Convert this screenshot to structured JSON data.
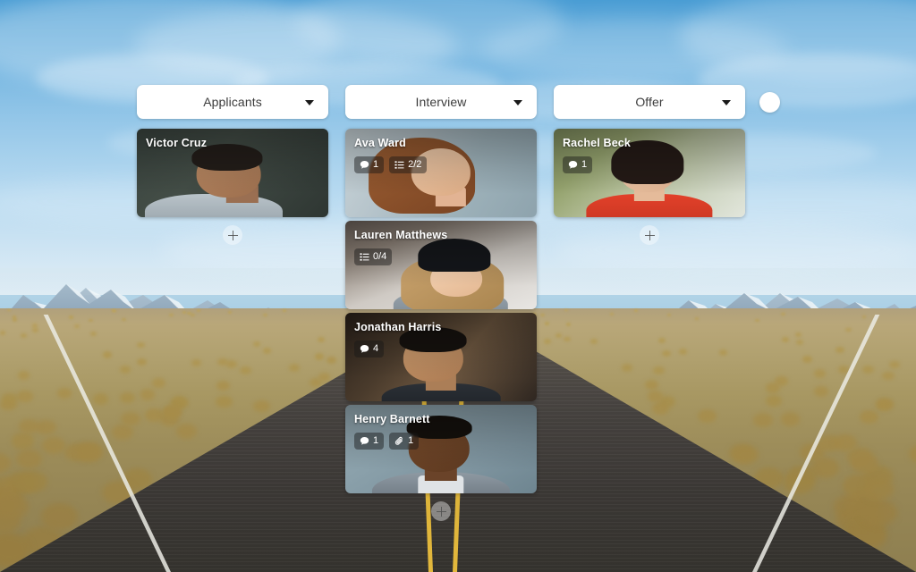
{
  "board": {
    "add_list_label": "+",
    "add_list_icon": "plus-icon"
  },
  "columns": [
    {
      "id": "applicants",
      "title": "Applicants",
      "caret_icon": "chevron-down-icon",
      "add_card_icon": "plus-icon",
      "cards": [
        {
          "name": "Victor Cruz",
          "badges": []
        }
      ]
    },
    {
      "id": "interview",
      "title": "Interview",
      "caret_icon": "chevron-down-icon",
      "add_card_icon": "plus-icon",
      "cards": [
        {
          "name": "Ava Ward",
          "badges": [
            {
              "icon": "comment-icon",
              "value": "1"
            },
            {
              "icon": "checklist-icon",
              "value": "2/2"
            }
          ]
        },
        {
          "name": "Lauren Matthews",
          "badges": [
            {
              "icon": "checklist-icon",
              "value": "0/4"
            }
          ]
        },
        {
          "name": "Jonathan Harris",
          "badges": [
            {
              "icon": "comment-icon",
              "value": "4"
            }
          ]
        },
        {
          "name": "Henry Barnett",
          "badges": [
            {
              "icon": "comment-icon",
              "value": "1"
            },
            {
              "icon": "attachment-icon",
              "value": "1"
            }
          ]
        }
      ]
    },
    {
      "id": "offer",
      "title": "Offer",
      "caret_icon": "chevron-down-icon",
      "add_card_icon": "plus-icon",
      "cards": [
        {
          "name": "Rachel Beck",
          "badges": [
            {
              "icon": "comment-icon",
              "value": "1"
            }
          ]
        }
      ]
    }
  ],
  "colors": {
    "header_bg": "#ffffff",
    "header_text": "#3c3c3c",
    "card_name_text": "#ffffff",
    "badge_bg": "rgba(25,25,25,0.46)",
    "sky_top": "#4a9dd4",
    "road": "#46423f",
    "center_line": "#d6ae38"
  }
}
